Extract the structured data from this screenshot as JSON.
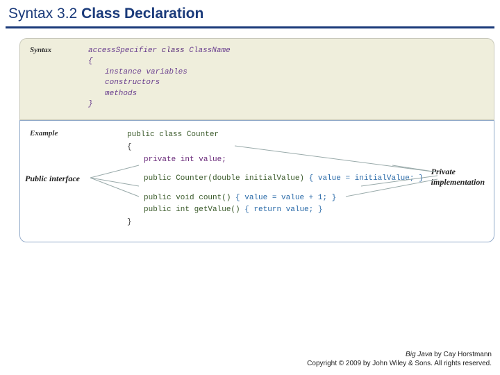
{
  "title": {
    "prefix": "Syntax",
    "num": "3.2",
    "name": "Class Declaration"
  },
  "syntax": {
    "label": "Syntax",
    "line1_access": "accessSpecifier",
    "line1_kw": "class",
    "line1_name": "ClassName",
    "brace_open": "{",
    "members": [
      "instance variables",
      "constructors",
      "methods"
    ],
    "brace_close": "}"
  },
  "example": {
    "label": "Example",
    "decl": "public class Counter",
    "brace_open": "{",
    "field": "private int value;",
    "ctor_sig": "public Counter(double initialValue)",
    "ctor_body": "{ value = initialValue; }",
    "m1_sig": "public void count()",
    "m1_body": "{ value = value + 1; }",
    "m2_sig": "public int getValue()",
    "m2_body": "{ return value; }",
    "brace_close": "}"
  },
  "annot": {
    "left": "Public interface",
    "right_l1": "Private",
    "right_l2": "implementation"
  },
  "footer": {
    "book": "Big Java",
    "byline": " by Cay Horstmann",
    "copy": "Copyright © 2009 by John Wiley & Sons.  All rights reserved."
  }
}
